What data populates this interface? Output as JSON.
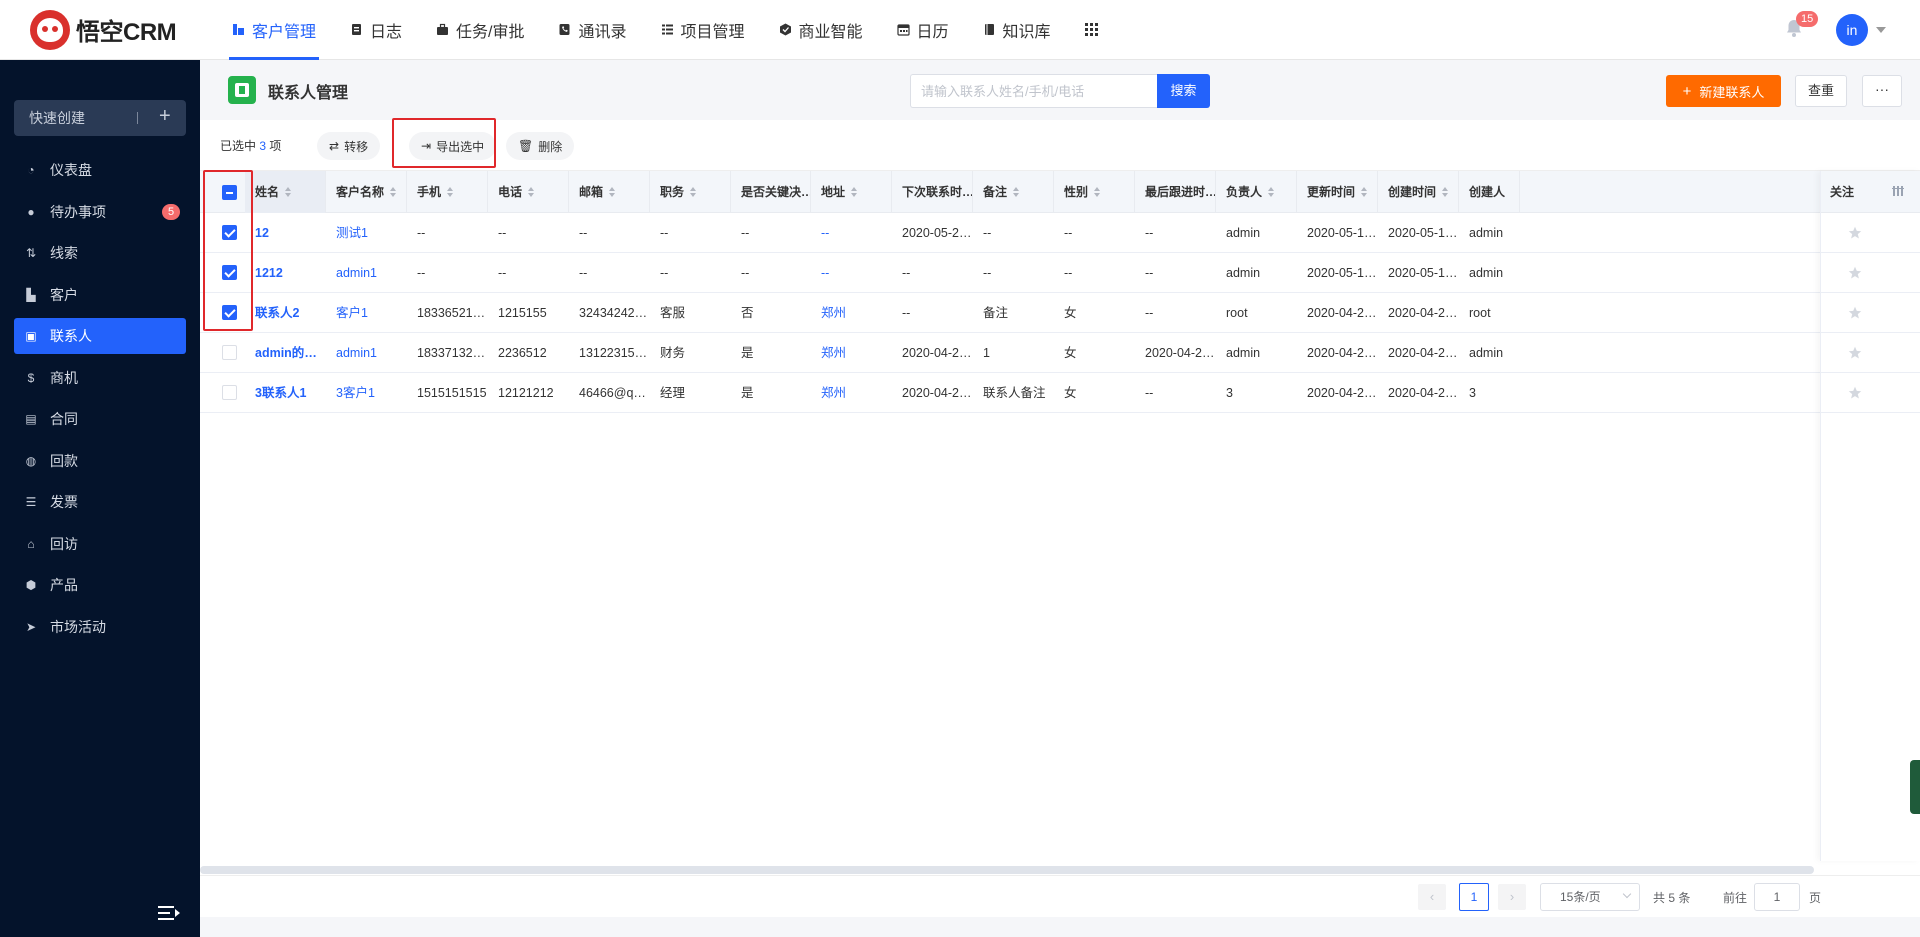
{
  "app": {
    "logo_text": "悟空CRM"
  },
  "nav": [
    {
      "label": "客户管理",
      "icon": "customer-icon",
      "active": true
    },
    {
      "label": "日志",
      "icon": "log-icon"
    },
    {
      "label": "任务/审批",
      "icon": "briefcase-icon"
    },
    {
      "label": "通讯录",
      "icon": "phone-book-icon"
    },
    {
      "label": "项目管理",
      "icon": "project-icon"
    },
    {
      "label": "商业智能",
      "icon": "bi-icon"
    },
    {
      "label": "日历",
      "icon": "calendar-icon"
    },
    {
      "label": "知识库",
      "icon": "book-icon"
    }
  ],
  "header": {
    "notification_count": "15",
    "avatar_text": "in"
  },
  "sidebar": {
    "quick_create": "快速创建",
    "items": [
      {
        "label": "仪表盘",
        "icon": "dashboard-icon"
      },
      {
        "label": "待办事项",
        "icon": "chat-icon",
        "badge": "5"
      },
      {
        "label": "线索",
        "icon": "lead-icon"
      },
      {
        "label": "客户",
        "icon": "building-icon"
      },
      {
        "label": "联系人",
        "icon": "contact-icon",
        "active": true
      },
      {
        "label": "商机",
        "icon": "dollar-icon"
      },
      {
        "label": "合同",
        "icon": "contract-icon"
      },
      {
        "label": "回款",
        "icon": "money-bag-icon"
      },
      {
        "label": "发票",
        "icon": "invoice-icon"
      },
      {
        "label": "回访",
        "icon": "home-icon"
      },
      {
        "label": "产品",
        "icon": "box-icon"
      },
      {
        "label": "市场活动",
        "icon": "paper-plane-icon"
      }
    ]
  },
  "page": {
    "title": "联系人管理",
    "search_placeholder": "请输入联系人姓名/手机/电话",
    "search_button": "搜索",
    "new_button": "新建联系人",
    "dedup_button": "查重",
    "more_button": "···"
  },
  "selection": {
    "prefix": "已选中",
    "count": "3",
    "suffix": "项",
    "transfer": "转移",
    "export": "导出选中",
    "delete": "删除"
  },
  "table": {
    "columns": [
      "姓名",
      "客户名称",
      "手机",
      "电话",
      "邮箱",
      "职务",
      "是否关键决…",
      "地址",
      "下次联系时…",
      "备注",
      "性别",
      "最后跟进时…",
      "负责人",
      "更新时间",
      "创建时间",
      "创建人",
      "关注"
    ],
    "rows": [
      {
        "checked": true,
        "cells": [
          "12",
          "测试1",
          "--",
          "--",
          "--",
          "--",
          "--",
          "--",
          "2020-05-2…",
          "--",
          "--",
          "--",
          "admin",
          "2020-05-1…",
          "2020-05-1…",
          "admin"
        ]
      },
      {
        "checked": true,
        "cells": [
          "1212",
          "admin1",
          "--",
          "--",
          "--",
          "--",
          "--",
          "--",
          "--",
          "--",
          "--",
          "--",
          "admin",
          "2020-05-1…",
          "2020-05-1…",
          "admin"
        ]
      },
      {
        "checked": true,
        "cells": [
          "联系人2",
          "客户1",
          "183365214…",
          "1215155",
          "324342423…",
          "客服",
          "否",
          "郑州",
          "--",
          "备注",
          "女",
          "--",
          "root",
          "2020-04-2…",
          "2020-04-2…",
          "root"
        ]
      },
      {
        "checked": false,
        "cells": [
          "admin的联…",
          "admin1",
          "183371322…",
          "2236512",
          "13122315…",
          "财务",
          "是",
          "郑州",
          "2020-04-2…",
          "1",
          "女",
          "2020-04-2…",
          "admin",
          "2020-04-2…",
          "2020-04-2…",
          "admin"
        ]
      },
      {
        "checked": false,
        "cells": [
          "3联系人1",
          "3客户1",
          "1515151515",
          "12121212",
          "46466@qq…",
          "经理",
          "是",
          "郑州",
          "2020-04-2…",
          "联系人备注",
          "女",
          "--",
          "3",
          "2020-04-2…",
          "2020-04-2…",
          "3"
        ]
      }
    ]
  },
  "pagination": {
    "current": "1",
    "page_size": "15条/页",
    "total": "共 5 条",
    "goto_label": "前往",
    "goto_value": "1",
    "page_label": "页"
  },
  "colors": {
    "primary": "#2362fb",
    "orange": "#ff6a00",
    "sidebar": "#04132b",
    "highlight": "#e0282b"
  }
}
